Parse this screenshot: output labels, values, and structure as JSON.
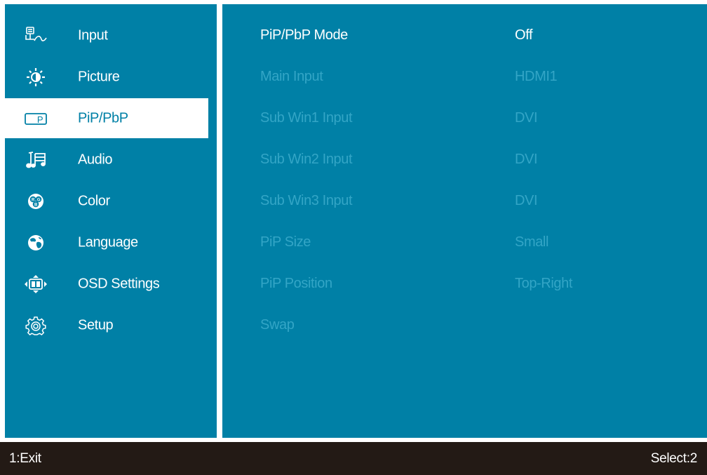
{
  "sidebar": {
    "items": [
      {
        "label": "Input",
        "icon": "input-icon"
      },
      {
        "label": "Picture",
        "icon": "brightness-icon"
      },
      {
        "label": "PiP/PbP",
        "icon": "pip-icon",
        "active": true
      },
      {
        "label": "Audio",
        "icon": "audio-icon"
      },
      {
        "label": "Color",
        "icon": "rgb-color-icon"
      },
      {
        "label": "Language",
        "icon": "globe-icon"
      },
      {
        "label": "OSD Settings",
        "icon": "osd-settings-icon"
      },
      {
        "label": "Setup",
        "icon": "gear-icon"
      }
    ]
  },
  "pip_icon_letter": "P",
  "color_icon_letters": [
    "R",
    "G",
    "B"
  ],
  "main": {
    "rows": [
      {
        "label": "PiP/PbP Mode",
        "value": "Off",
        "enabled": true
      },
      {
        "label": "Main Input",
        "value": "HDMI1",
        "enabled": false
      },
      {
        "label": "Sub Win1 Input",
        "value": "DVI",
        "enabled": false
      },
      {
        "label": "Sub Win2 Input",
        "value": "DVI",
        "enabled": false
      },
      {
        "label": "Sub Win3 Input",
        "value": "DVI",
        "enabled": false
      },
      {
        "label": "PiP Size",
        "value": "Small",
        "enabled": false
      },
      {
        "label": "PiP Position",
        "value": "Top-Right",
        "enabled": false
      },
      {
        "label": "Swap",
        "value": "",
        "enabled": false
      }
    ]
  },
  "footer": {
    "exit_label": "1:Exit",
    "select_label": "Select:2"
  },
  "colors": {
    "panel": "#0080a6",
    "footer": "#231a15",
    "disabled_text": "#33a5c6",
    "active_bg": "#ffffff"
  }
}
